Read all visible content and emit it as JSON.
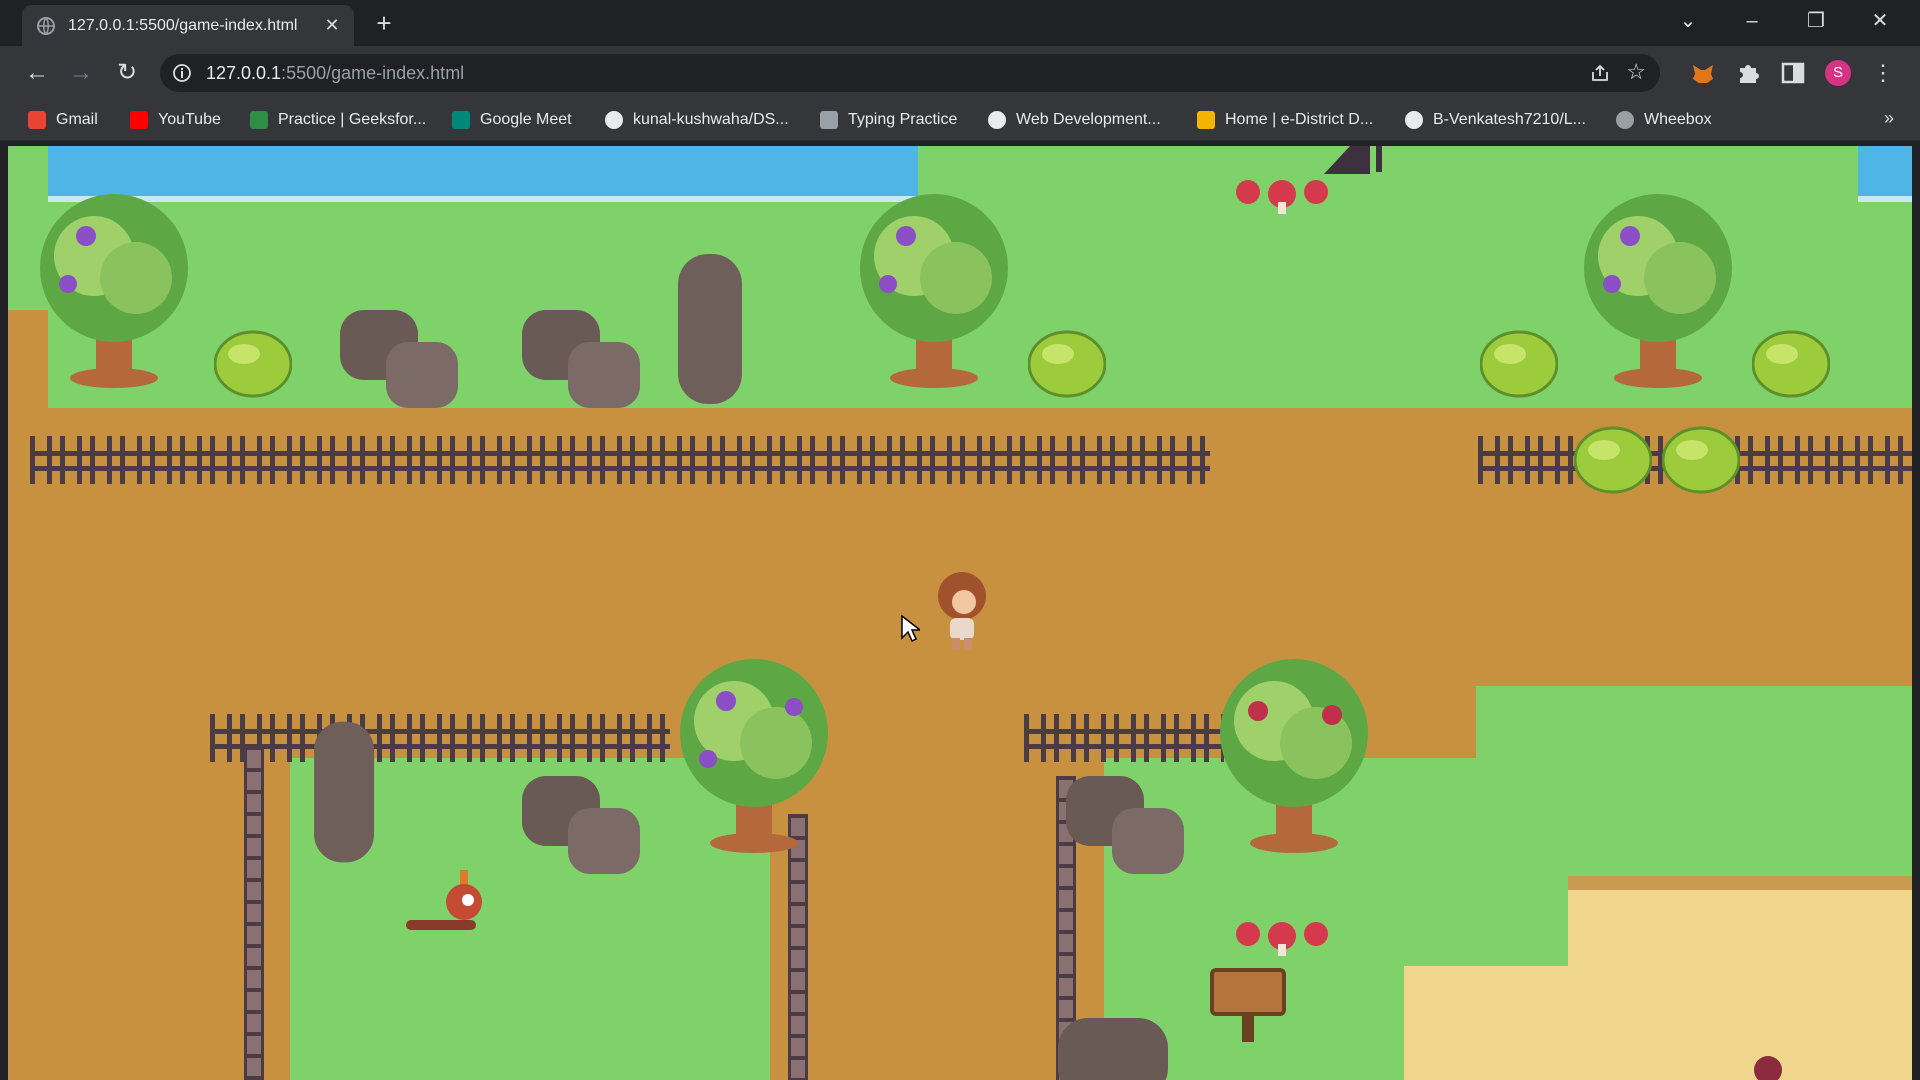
{
  "browser": {
    "tab": {
      "title": "127.0.0.1:5500/game-index.html"
    },
    "url": {
      "host": "127.0.0.1",
      "path": ":5500/game-index.html"
    },
    "profile_initial": "S",
    "bookmarks": [
      {
        "label": "Gmail",
        "icon": "gmail-icon",
        "color": "#ea4335"
      },
      {
        "label": "YouTube",
        "icon": "youtube-icon",
        "color": "#ff0000"
      },
      {
        "label": "Practice | Geeksfor...",
        "icon": "geeksforgeeks-icon",
        "color": "#2f8d46"
      },
      {
        "label": "Google Meet",
        "icon": "google-meet-icon",
        "color": "#00897b"
      },
      {
        "label": "kunal-kushwaha/DS...",
        "icon": "github-icon",
        "color": "#e8eaed"
      },
      {
        "label": "Typing Practice",
        "icon": "typing-icon",
        "color": "#9aa0a6"
      },
      {
        "label": "Web Development...",
        "icon": "web-icon",
        "color": "#e8eaed"
      },
      {
        "label": "Home | e-District D...",
        "icon": "edistrict-icon",
        "color": "#f4b400"
      },
      {
        "label": "B-Venkatesh7210/L...",
        "icon": "github-icon",
        "color": "#e8eaed"
      },
      {
        "label": "Wheebox",
        "icon": "globe-icon",
        "color": "#9aa0a6"
      }
    ]
  },
  "colors": {
    "grass": "#7fd16a",
    "dirt": "#c8913f",
    "water": "#4fb4e6",
    "sand": "#f0d68c",
    "fence": "#4a3b47"
  }
}
